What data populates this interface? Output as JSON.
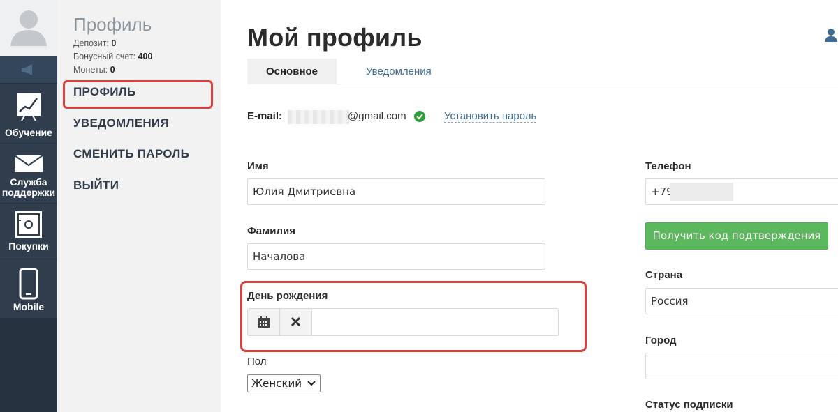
{
  "rail": {
    "items": [
      {
        "label": "Обучение",
        "icon": "chart-icon"
      },
      {
        "label": "Служба поддержки",
        "line1": "Служба",
        "line2": "поддержки",
        "icon": "mail-icon"
      },
      {
        "label": "Покупки",
        "icon": "safe-icon"
      },
      {
        "label": "Mobile",
        "icon": "mobile-icon"
      }
    ]
  },
  "sidebar": {
    "title": "Профиль",
    "stats": {
      "deposit_label": "Депозит:",
      "deposit_value": "0",
      "bonus_label": "Бонусный счет:",
      "bonus_value": "400",
      "coins_label": "Монеты:",
      "coins_value": "0"
    },
    "links": [
      "ПРОФИЛЬ",
      "УВЕДОМЛЕНИЯ",
      "СМЕНИТЬ ПАРОЛЬ",
      "ВЫЙТИ"
    ]
  },
  "main": {
    "title": "Мой профиль",
    "tabs": [
      "Основное",
      "Уведомления"
    ],
    "email": {
      "label": "E-mail:",
      "value": "@gmail.com",
      "set_password": "Установить пароль"
    },
    "fields": {
      "first_name": {
        "label": "Имя",
        "value": "Юлия Дмитриевна"
      },
      "last_name": {
        "label": "Фамилия",
        "value": "Началова"
      },
      "birthday": {
        "label": "День рождения",
        "value": ""
      },
      "gender": {
        "label": "Пол",
        "value": "Женский"
      },
      "phone": {
        "label": "Телефон",
        "value": "+79"
      },
      "get_code": "Получить код подтверждения",
      "country": {
        "label": "Страна",
        "value": "Россия"
      },
      "city": {
        "label": "Город",
        "value": ""
      },
      "subscription": {
        "label": "Статус подписки"
      }
    }
  },
  "colors": {
    "rail": "#2f3d4d",
    "highlight": "#d8413f",
    "link": "#3e6c94",
    "success": "#5cb85c"
  }
}
